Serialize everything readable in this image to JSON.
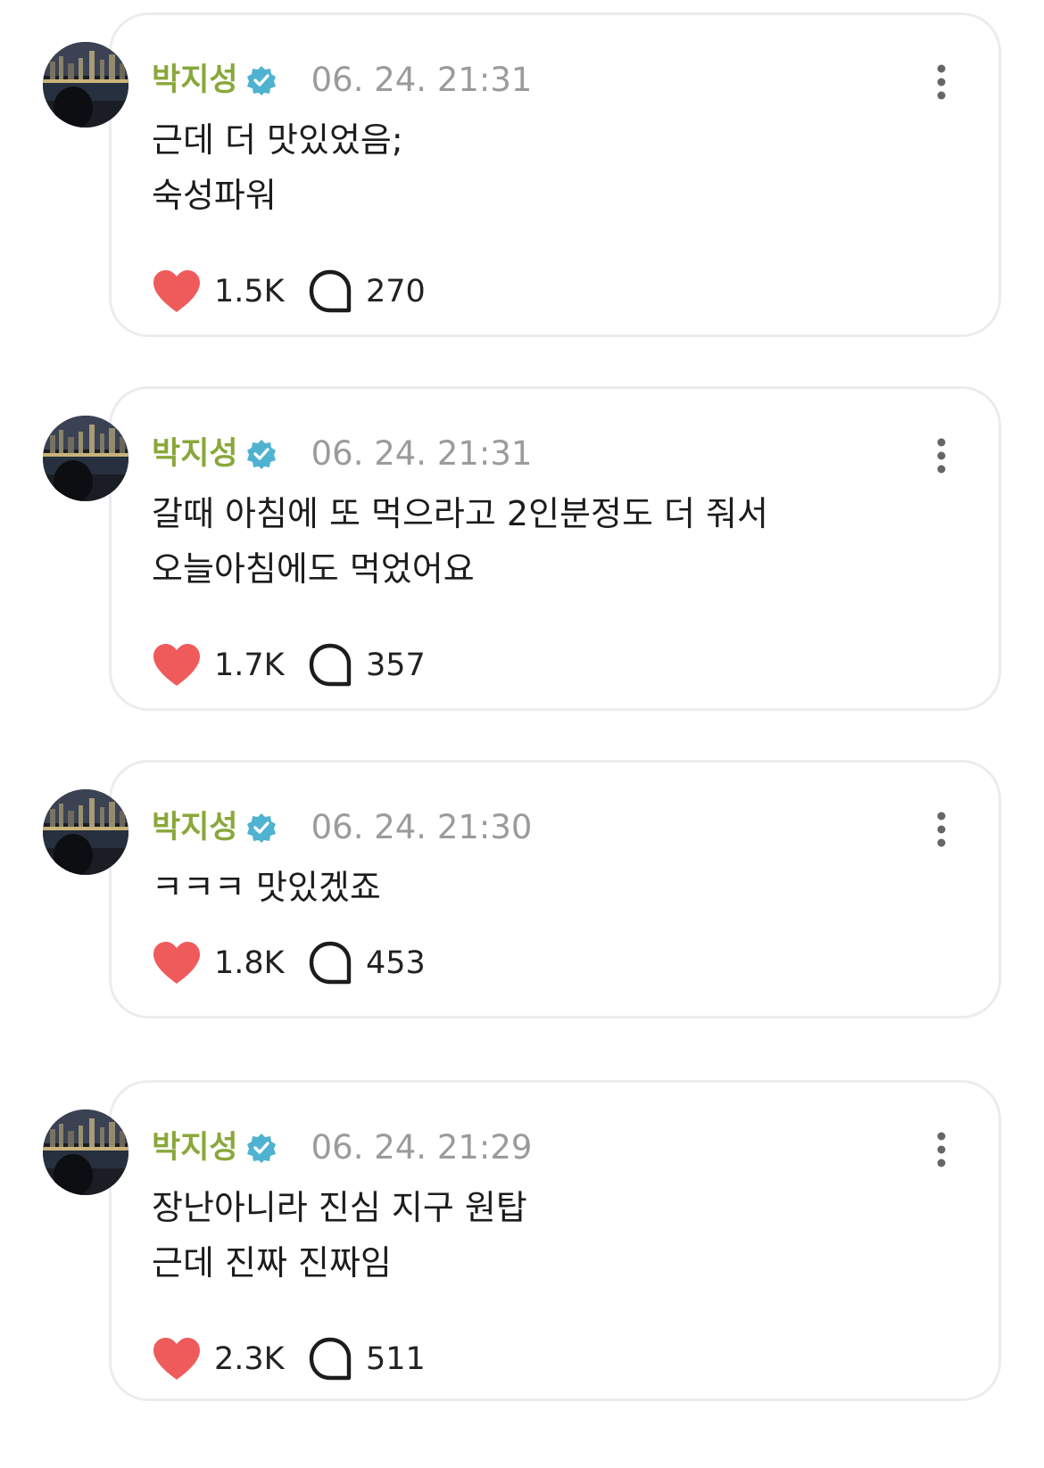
{
  "colors": {
    "name": "#88a83a",
    "badge": "#4fb2d1",
    "heart": "#ef5b5b",
    "time": "#9b9b9b",
    "border": "#ececf0"
  },
  "posts": [
    {
      "author": "박지성",
      "time": "06. 24. 21:31",
      "lines": [
        "근데 더 맛있었음;",
        "숙성파워"
      ],
      "likes": "1.5K",
      "comments": "270"
    },
    {
      "author": "박지성",
      "time": "06. 24. 21:31",
      "lines": [
        "갈때 아침에 또 먹으라고 2인분정도 더 줘서",
        "오늘아침에도 먹었어요"
      ],
      "likes": "1.7K",
      "comments": "357"
    },
    {
      "author": "박지성",
      "time": "06. 24. 21:30",
      "lines": [
        "ㅋㅋㅋ 맛있겠죠"
      ],
      "likes": "1.8K",
      "comments": "453"
    },
    {
      "author": "박지성",
      "time": "06. 24. 21:29",
      "lines": [
        "장난아니라 진심 지구 원탑",
        "근데 진짜 진짜임"
      ],
      "likes": "2.3K",
      "comments": "511"
    }
  ]
}
